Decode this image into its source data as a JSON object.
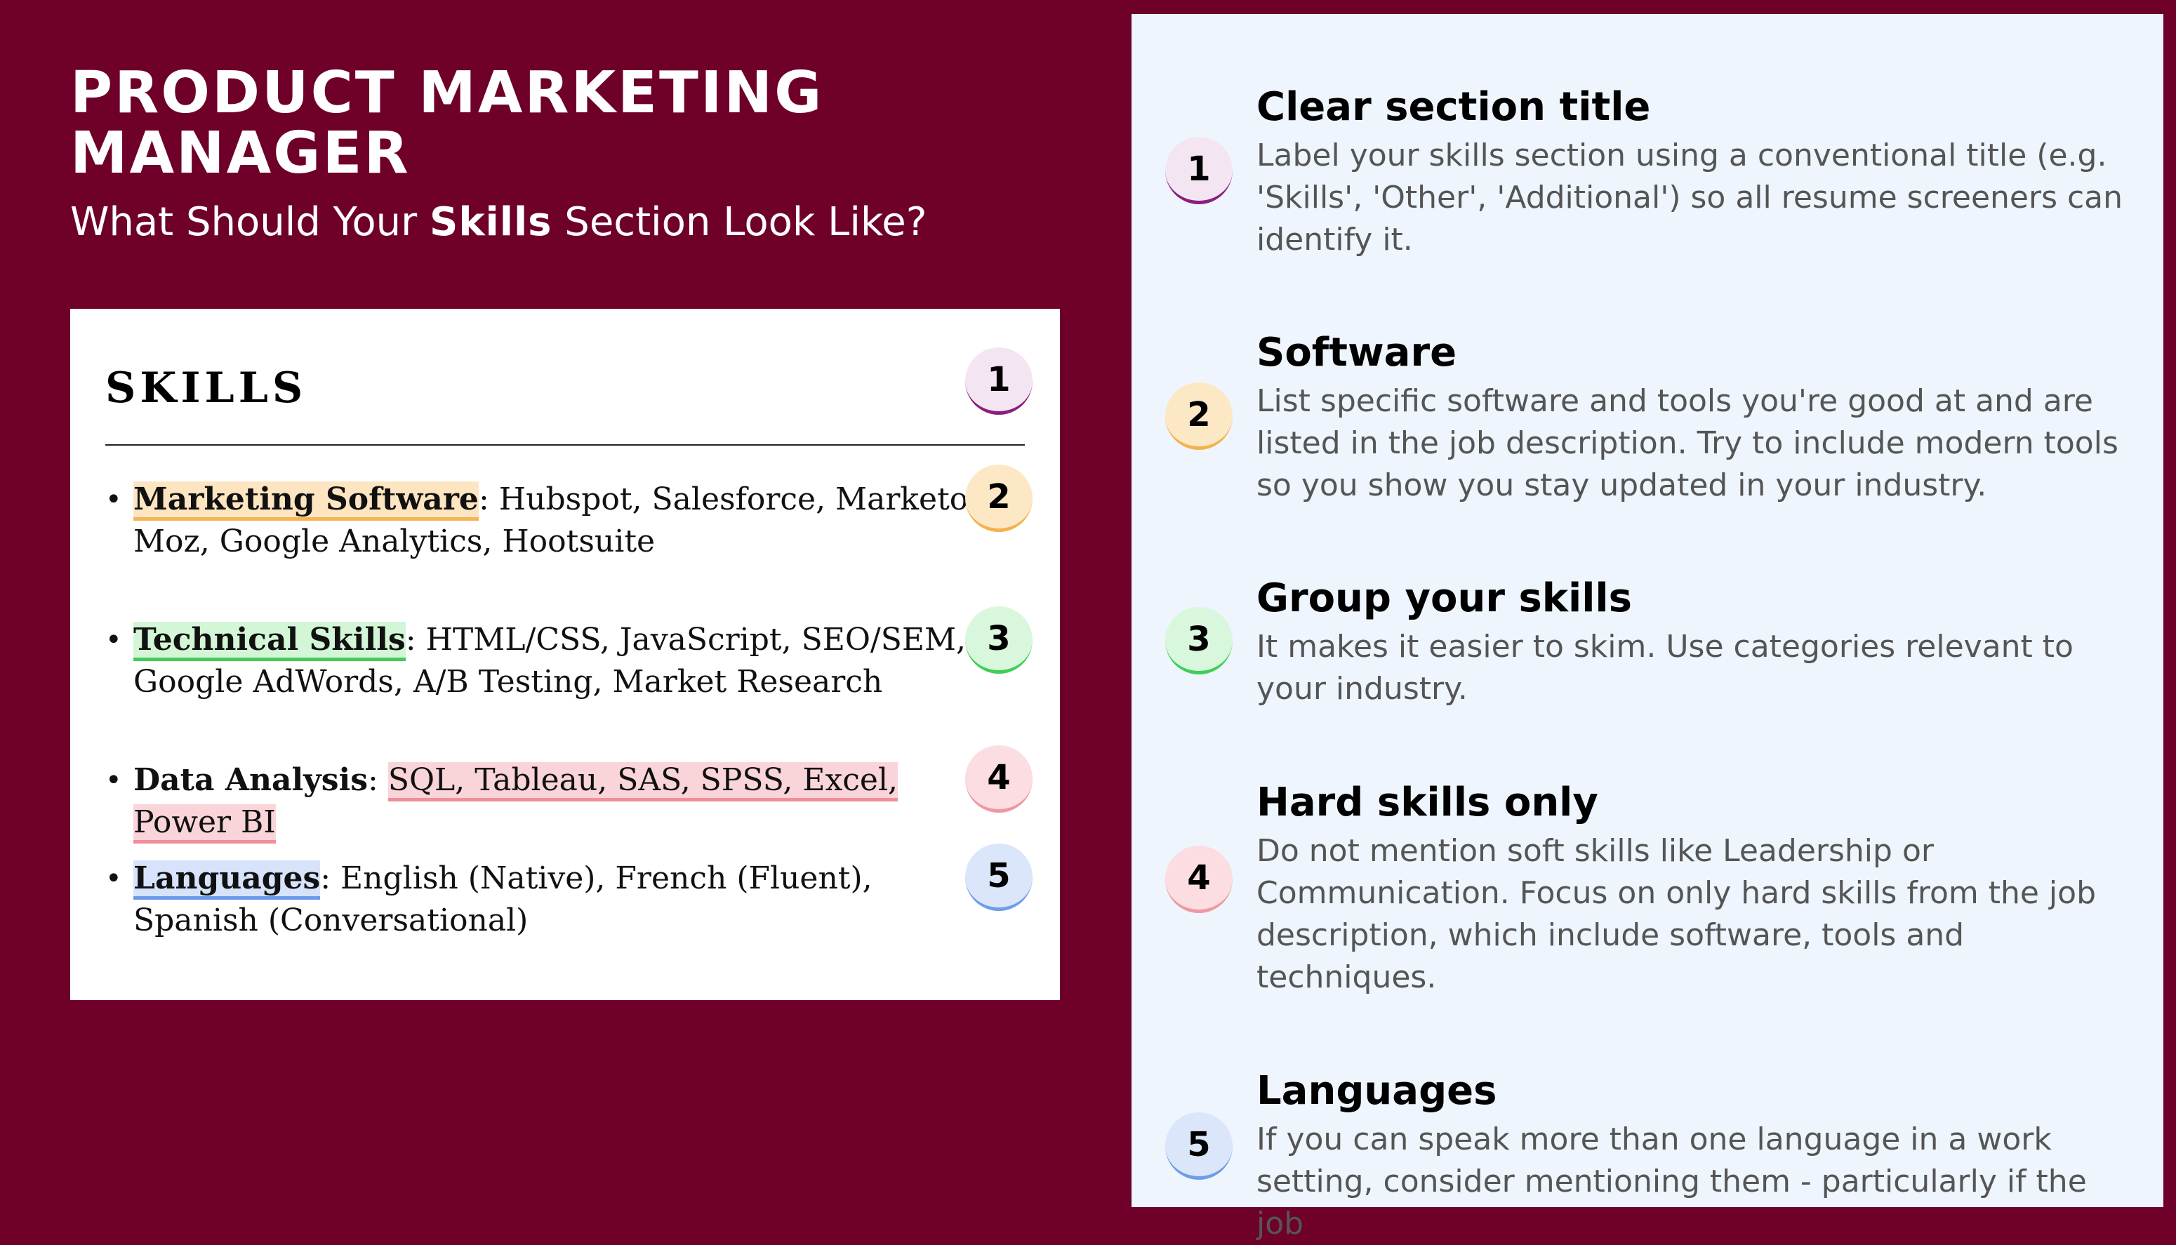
{
  "header": {
    "title": "PRODUCT MARKETING MANAGER",
    "subtitle_prefix": "What Should Your ",
    "subtitle_strong": "Skills",
    "subtitle_suffix": " Section Look Like?"
  },
  "resume": {
    "heading": "SKILLS",
    "heading_badge": "1",
    "items": [
      {
        "category": "Marketing Software",
        "sep": ": ",
        "details": "Hubspot, Salesforce, Marketo, Moz, Google Analytics, Hootsuite",
        "badge": "2"
      },
      {
        "category": "Technical Skills",
        "sep": ": ",
        "details": "HTML/CSS, JavaScript, SEO/SEM, Google AdWords, A/B Testing, Market Research",
        "badge": "3"
      },
      {
        "category": "Data Analysis",
        "sep": ": ",
        "details": "SQL, Tableau, SAS, SPSS, Excel, Power BI",
        "badge": "4"
      },
      {
        "category": "Languages",
        "sep": ": ",
        "details": "English (Native), French (Fluent), Spanish (Conversational)",
        "badge": "5"
      }
    ]
  },
  "tips": [
    {
      "number": "1",
      "title": "Clear section title",
      "text": "Label your skills section using a conventional title (e.g. 'Skills', 'Other', 'Additional') so all resume screeners can identify it."
    },
    {
      "number": "2",
      "title": "Software",
      "text": "List specific software and tools you're good at and are listed in the job description. Try to include modern tools so you show you stay updated in your industry."
    },
    {
      "number": "3",
      "title": "Group your skills",
      "text": "It makes it easier to skim. Use categories relevant to your industry."
    },
    {
      "number": "4",
      "title": "Hard skills only",
      "text": "Do not mention soft skills like Leadership or Communication. Focus on only hard skills from the job description, which include software, tools and techniques."
    },
    {
      "number": "5",
      "title": "Languages",
      "text": "If you can speak more than one language in a work setting, consider mentioning them - particularly if the job"
    }
  ],
  "colors": {
    "background": "#6e0029",
    "panel": "#eef5fd",
    "badge_1": "#8a1f7a",
    "badge_2": "#f4b24e",
    "badge_3": "#3fcf56",
    "badge_4": "#ee98a4",
    "badge_5": "#6f9de6"
  }
}
